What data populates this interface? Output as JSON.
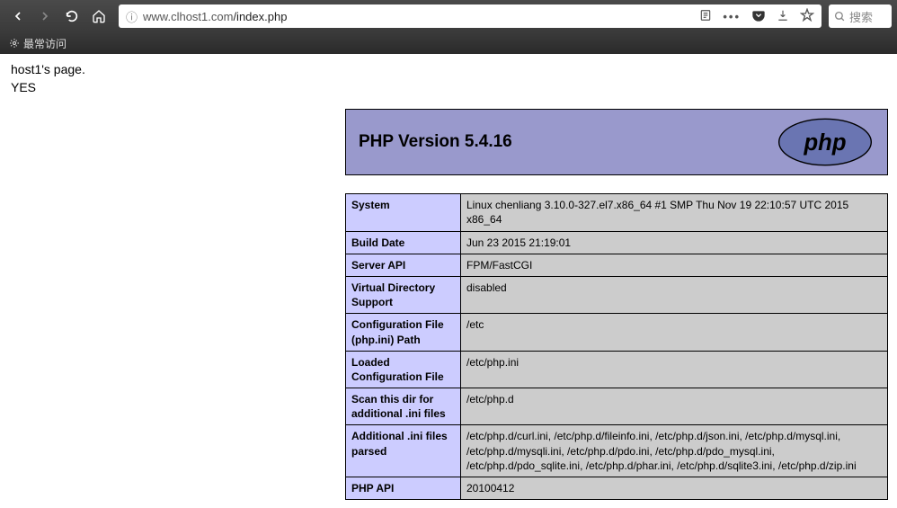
{
  "browser": {
    "url_host": "www.clhost1.com",
    "url_path": "/index.php",
    "search_placeholder": "搜索",
    "bookmark_label": "最常访问"
  },
  "page": {
    "line1": "host1's page.",
    "line2": "YES"
  },
  "phpinfo": {
    "title": "PHP Version 5.4.16",
    "rows": [
      {
        "k": "System",
        "v": "Linux chenliang 3.10.0-327.el7.x86_64 #1 SMP Thu Nov 19 22:10:57 UTC 2015 x86_64"
      },
      {
        "k": "Build Date",
        "v": "Jun 23 2015 21:19:01"
      },
      {
        "k": "Server API",
        "v": "FPM/FastCGI"
      },
      {
        "k": "Virtual Directory Support",
        "v": "disabled"
      },
      {
        "k": "Configuration File (php.ini) Path",
        "v": "/etc"
      },
      {
        "k": "Loaded Configuration File",
        "v": "/etc/php.ini"
      },
      {
        "k": "Scan this dir for additional .ini files",
        "v": "/etc/php.d"
      },
      {
        "k": "Additional .ini files parsed",
        "v": "/etc/php.d/curl.ini, /etc/php.d/fileinfo.ini, /etc/php.d/json.ini, /etc/php.d/mysql.ini, /etc/php.d/mysqli.ini, /etc/php.d/pdo.ini, /etc/php.d/pdo_mysql.ini, /etc/php.d/pdo_sqlite.ini, /etc/php.d/phar.ini, /etc/php.d/sqlite3.ini, /etc/php.d/zip.ini"
      },
      {
        "k": "PHP API",
        "v": "20100412"
      }
    ]
  }
}
